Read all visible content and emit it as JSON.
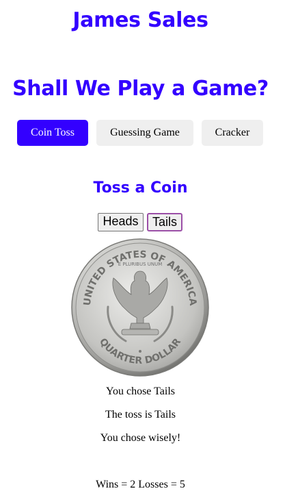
{
  "site_title": "James Sales",
  "hero_title": "Shall We Play a Game?",
  "nav": {
    "tabs": [
      {
        "label": "Coin Toss",
        "active": true
      },
      {
        "label": "Guessing Game",
        "active": false
      },
      {
        "label": "Cracker",
        "active": false
      }
    ]
  },
  "coin_toss": {
    "title": "Toss a Coin",
    "heads_label": "Heads",
    "tails_label": "Tails",
    "coin": {
      "icon": "coin-tails-icon",
      "rim_text_top": "UNITED STATES OF AMERICA",
      "rim_text_bottom": "QUARTER DOLLAR",
      "motto": "E PLURIBUS UNUM"
    },
    "user_choice_text": "You chose Tails",
    "toss_result_text": "The toss is Tails",
    "verdict_text": "You chose wisely!",
    "score_text": "Wins = 2 Losses = 5"
  },
  "colors": {
    "accent": "#3300ff",
    "button_bg": "#efefef",
    "focus_ring": "#9b4fa7"
  }
}
